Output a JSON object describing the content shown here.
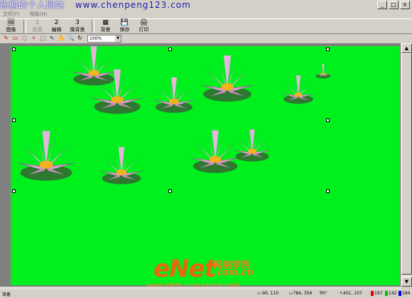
{
  "watermark_top": {
    "site": "陈鹏的个人网站",
    "url": "www.chenpeng123.com"
  },
  "window_buttons": [
    "_",
    "□",
    "×"
  ],
  "menu": [
    "文件(F)",
    "帮助(H)"
  ],
  "toolbar": [
    {
      "label": "图像",
      "icon": "image-icon",
      "enabled": true
    },
    {
      "label": "抠图",
      "icon": "cutout-icon",
      "enabled": false
    },
    {
      "label": "编辑",
      "icon": "edit-icon",
      "enabled": true
    },
    {
      "label": "换背景",
      "icon": "replace-bg-icon",
      "enabled": true
    },
    {
      "label": "背景",
      "icon": "background-icon",
      "enabled": true
    },
    {
      "label": "保存",
      "icon": "save-icon",
      "enabled": true
    },
    {
      "label": "打印",
      "icon": "print-icon",
      "enabled": true
    }
  ],
  "toolbar_numbers": {
    "step1": "1",
    "step2": "2",
    "step3": "3"
  },
  "zoom": {
    "value": "100%"
  },
  "canvas": {
    "background": "#00f01e"
  },
  "status": {
    "ready": "准备",
    "size": "-90, 110",
    "dimensions": "784, 356",
    "angle": "0°",
    "cursor": "401, 107",
    "r": "197",
    "g": "142",
    "b": "184"
  },
  "brand": {
    "logo": "eNet",
    "cn": "网络学院",
    "domain": ".com.cn",
    "url": "www.eNet.com.cn/eschool"
  }
}
